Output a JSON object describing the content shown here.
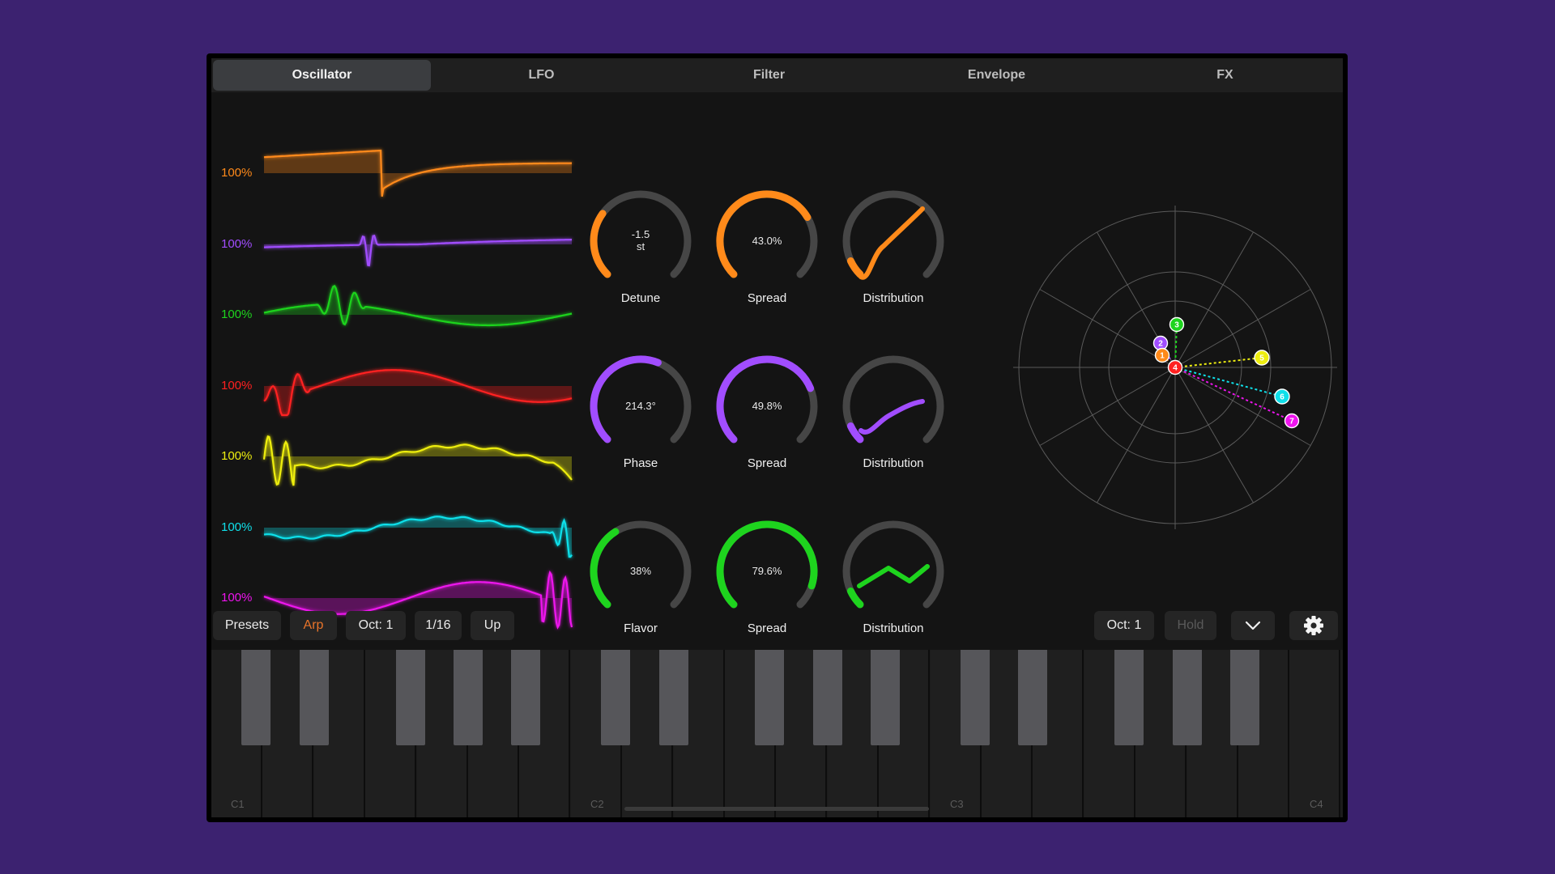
{
  "tabs": [
    "Oscillator",
    "LFO",
    "Filter",
    "Envelope",
    "FX"
  ],
  "active_tab": "Oscillator",
  "voices": [
    {
      "percent": "100%",
      "color": "#ff8a1a"
    },
    {
      "percent": "100%",
      "color": "#a14dff"
    },
    {
      "percent": "100%",
      "color": "#1ed41e"
    },
    {
      "percent": "100%",
      "color": "#ff2020"
    },
    {
      "percent": "100%",
      "color": "#eeee10"
    },
    {
      "percent": "100%",
      "color": "#10e0ea"
    },
    {
      "percent": "100%",
      "color": "#ee14ee"
    }
  ],
  "knob_rows": [
    {
      "color": "#ff8a1a",
      "knobs": [
        {
          "label": "Detune",
          "value_line1": "-1.5",
          "value_line2": "st",
          "level": 0.3
        },
        {
          "label": "Spread",
          "value_line1": "43.0%",
          "value_line2": "",
          "level": 0.72
        },
        {
          "label": "Distribution",
          "value_line1": "",
          "value_line2": "",
          "level": 0.0
        }
      ]
    },
    {
      "color": "#a14dff",
      "knobs": [
        {
          "label": "Phase",
          "value_line1": "214.3°",
          "value_line2": "",
          "level": 0.58
        },
        {
          "label": "Spread",
          "value_line1": "49.8%",
          "value_line2": "",
          "level": 0.75
        },
        {
          "label": "Distribution",
          "value_line1": "",
          "value_line2": "",
          "level": 0.0
        }
      ]
    },
    {
      "color": "#1ed41e",
      "knobs": [
        {
          "label": "Flavor",
          "value_line1": "38%",
          "value_line2": "",
          "level": 0.38
        },
        {
          "label": "Spread",
          "value_line1": "79.6%",
          "value_line2": "",
          "level": 0.9
        },
        {
          "label": "Distribution",
          "value_line1": "",
          "value_line2": "",
          "level": 0.0
        }
      ]
    }
  ],
  "polar_points": [
    {
      "label": "3",
      "color": "#1ed41e"
    },
    {
      "label": "2",
      "color": "#a14dff"
    },
    {
      "label": "1",
      "color": "#ff8a1a"
    },
    {
      "label": "4",
      "color": "#ff2020"
    },
    {
      "label": "5",
      "color": "#eeee10"
    },
    {
      "label": "6",
      "color": "#10e0ea"
    },
    {
      "label": "7",
      "color": "#ee14ee"
    }
  ],
  "toolbar": {
    "presets": "Presets",
    "arp": "Arp",
    "arp_color": "#e8742a",
    "oct_left": "Oct: 1",
    "rate": "1/16",
    "direction": "Up",
    "oct_right": "Oct: 1",
    "hold": "Hold"
  },
  "keyboard": {
    "octave_labels": [
      "C1",
      "C2",
      "C3",
      "C4"
    ]
  },
  "icons": {
    "chevron": "chevron-down-icon",
    "settings": "gear-icon"
  }
}
